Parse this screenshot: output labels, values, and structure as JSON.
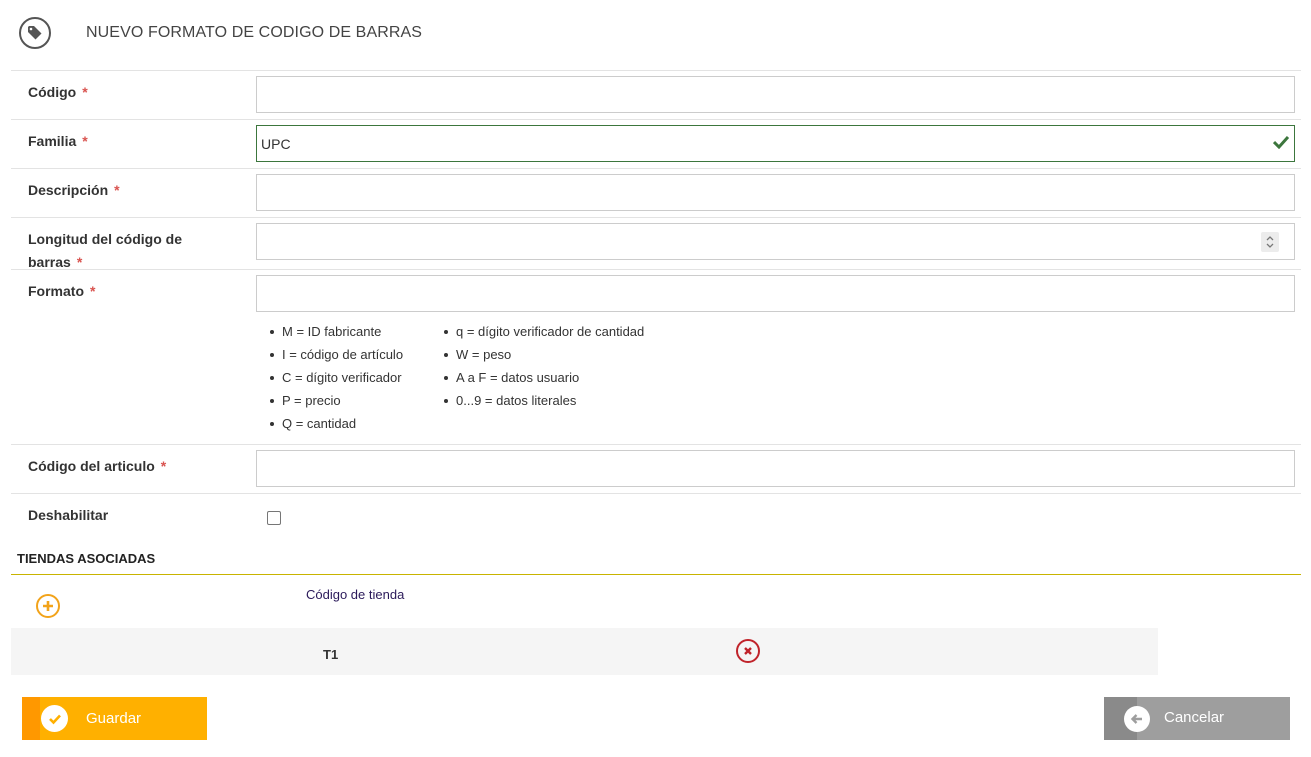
{
  "header": {
    "title": "NUEVO FORMATO DE CODIGO DE BARRAS",
    "icon": "tag-icon"
  },
  "required_marker": "*",
  "fields": {
    "codigo": {
      "label": "Código",
      "value": ""
    },
    "familia": {
      "label": "Familia",
      "value": "UPC"
    },
    "descripcion": {
      "label": "Descripción",
      "value": ""
    },
    "longitud": {
      "label": "Longitud del código de barras",
      "value": ""
    },
    "formato": {
      "label": "Formato",
      "value": ""
    },
    "codigo_articulo": {
      "label": "Código del articulo",
      "value": ""
    },
    "deshabilitar": {
      "label": "Deshabilitar",
      "checked": false
    }
  },
  "formato_help": {
    "left": [
      "M = ID fabricante",
      "I = código de artículo",
      "C = dígito verificador",
      "P = precio",
      "Q = cantidad"
    ],
    "right": [
      "q = dígito verificador de cantidad",
      "W = peso",
      "A a F = datos usuario",
      "0...9 = datos literales"
    ]
  },
  "tiendas": {
    "title": "TIENDAS ASOCIADAS",
    "column_header": "Código de tienda",
    "rows": [
      {
        "code": "T1"
      }
    ]
  },
  "actions": {
    "save_label": "Guardar",
    "cancel_label": "Cancelar"
  },
  "colors": {
    "accent": "#ffb000",
    "accent_dark": "#ff9800",
    "valid": "#3c763d",
    "danger": "#c0232a",
    "cancel": "#9e9e9e"
  }
}
